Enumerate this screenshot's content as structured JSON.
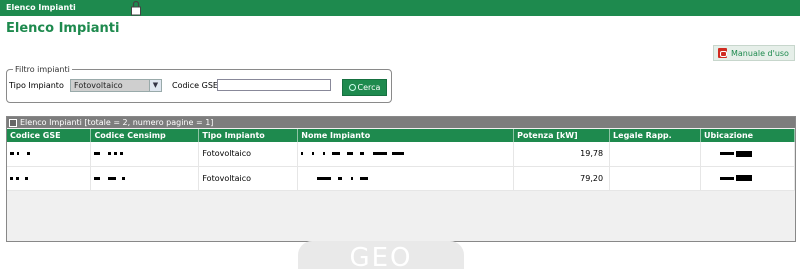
{
  "window": {
    "title": "Elenco Impianti",
    "lock_icon": "padlock-icon"
  },
  "page": {
    "title": "Elenco Impianti"
  },
  "manual_button": {
    "label": "Manuale d'uso",
    "icon": "pdf-icon"
  },
  "filter": {
    "legend": "Filtro impianti",
    "tipo_label": "Tipo Impianto",
    "tipo_value": "Fotovoltaico",
    "codice_label": "Codice GSE",
    "codice_value": "",
    "search_label": "Cerca",
    "search_icon": "search-icon"
  },
  "grid": {
    "title": "Elenco Impianti [totale = 2, numero pagine = 1]",
    "columns": [
      "Codice GSE",
      "Codice Censimp",
      "Tipo Impianto",
      "Nome Impianto",
      "Potenza [kW]",
      "Legale Rapp.",
      "Ubicazione"
    ],
    "rows": [
      {
        "tipo": "Fotovoltaico",
        "potenza": "19,78",
        "legale": ""
      },
      {
        "tipo": "Fotovoltaico",
        "potenza": "79,20",
        "legale": ""
      }
    ]
  },
  "watermark": {
    "text": "GEO"
  },
  "colors": {
    "brand_green": "#1e8a4e",
    "panel_gray": "#7d7d7d"
  }
}
